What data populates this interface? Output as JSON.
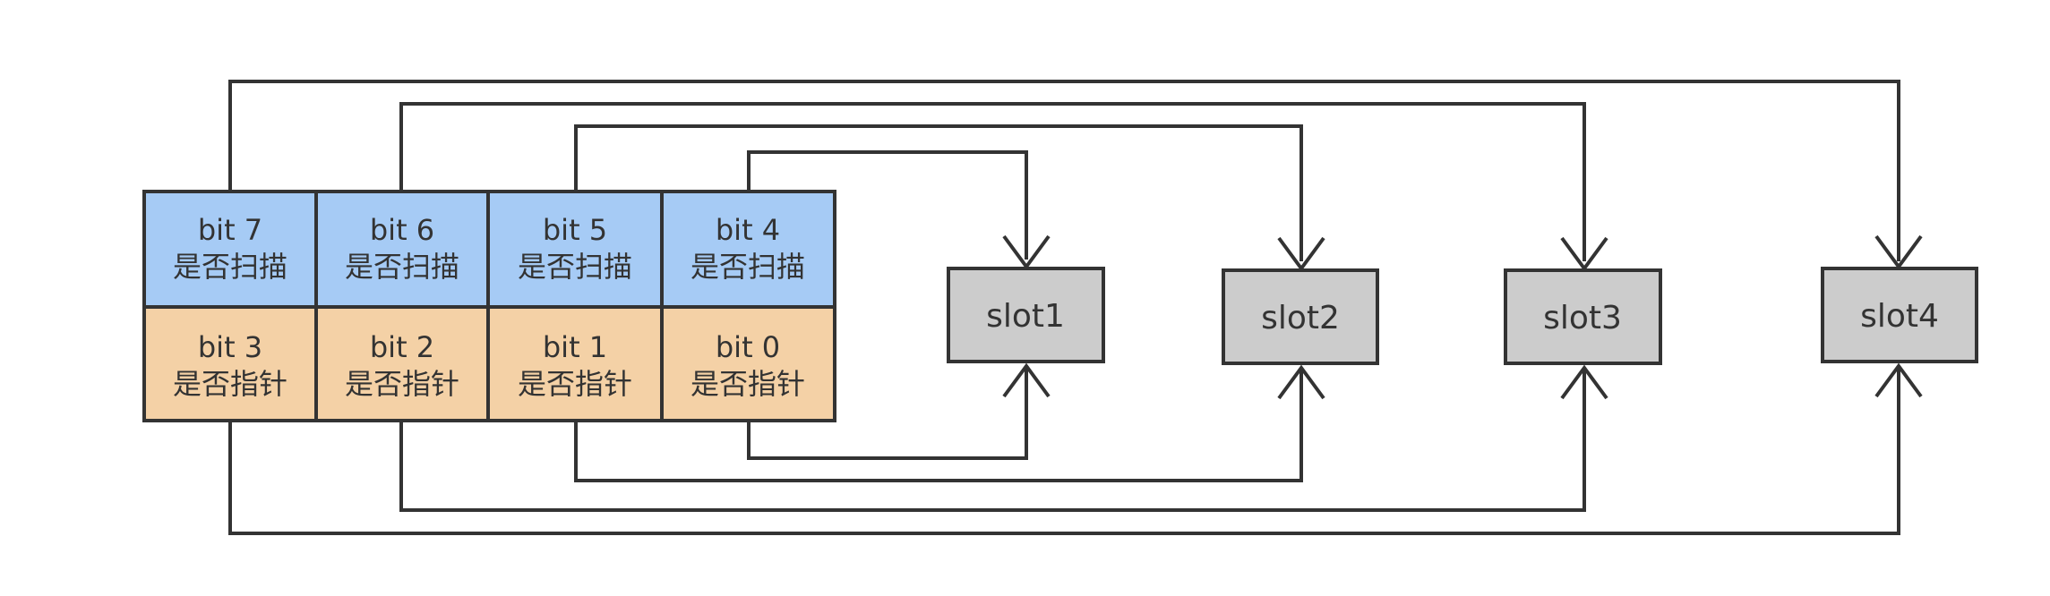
{
  "colors": {
    "scan_row_fill": "#a6cbf5",
    "pointer_row_fill": "#f4d1a6",
    "slot_fill": "#cccccc",
    "stroke": "#333333",
    "text": "#333333",
    "background": "#ffffff"
  },
  "bitfield": {
    "scan_row": [
      {
        "bit": "bit 7",
        "meaning": "是否扫描"
      },
      {
        "bit": "bit 6",
        "meaning": "是否扫描"
      },
      {
        "bit": "bit 5",
        "meaning": "是否扫描"
      },
      {
        "bit": "bit 4",
        "meaning": "是否扫描"
      }
    ],
    "pointer_row": [
      {
        "bit": "bit 3",
        "meaning": "是否指针"
      },
      {
        "bit": "bit 2",
        "meaning": "是否指针"
      },
      {
        "bit": "bit 1",
        "meaning": "是否指针"
      },
      {
        "bit": "bit 0",
        "meaning": "是否指针"
      }
    ]
  },
  "slots": [
    {
      "label": "slot1"
    },
    {
      "label": "slot2"
    },
    {
      "label": "slot3"
    },
    {
      "label": "slot4"
    }
  ],
  "connections": [
    {
      "from": "bit 4",
      "to": "slot1"
    },
    {
      "from": "bit 5",
      "to": "slot2"
    },
    {
      "from": "bit 6",
      "to": "slot3"
    },
    {
      "from": "bit 7",
      "to": "slot4"
    },
    {
      "from": "bit 0",
      "to": "slot1"
    },
    {
      "from": "bit 1",
      "to": "slot2"
    },
    {
      "from": "bit 2",
      "to": "slot3"
    },
    {
      "from": "bit 3",
      "to": "slot4"
    }
  ]
}
